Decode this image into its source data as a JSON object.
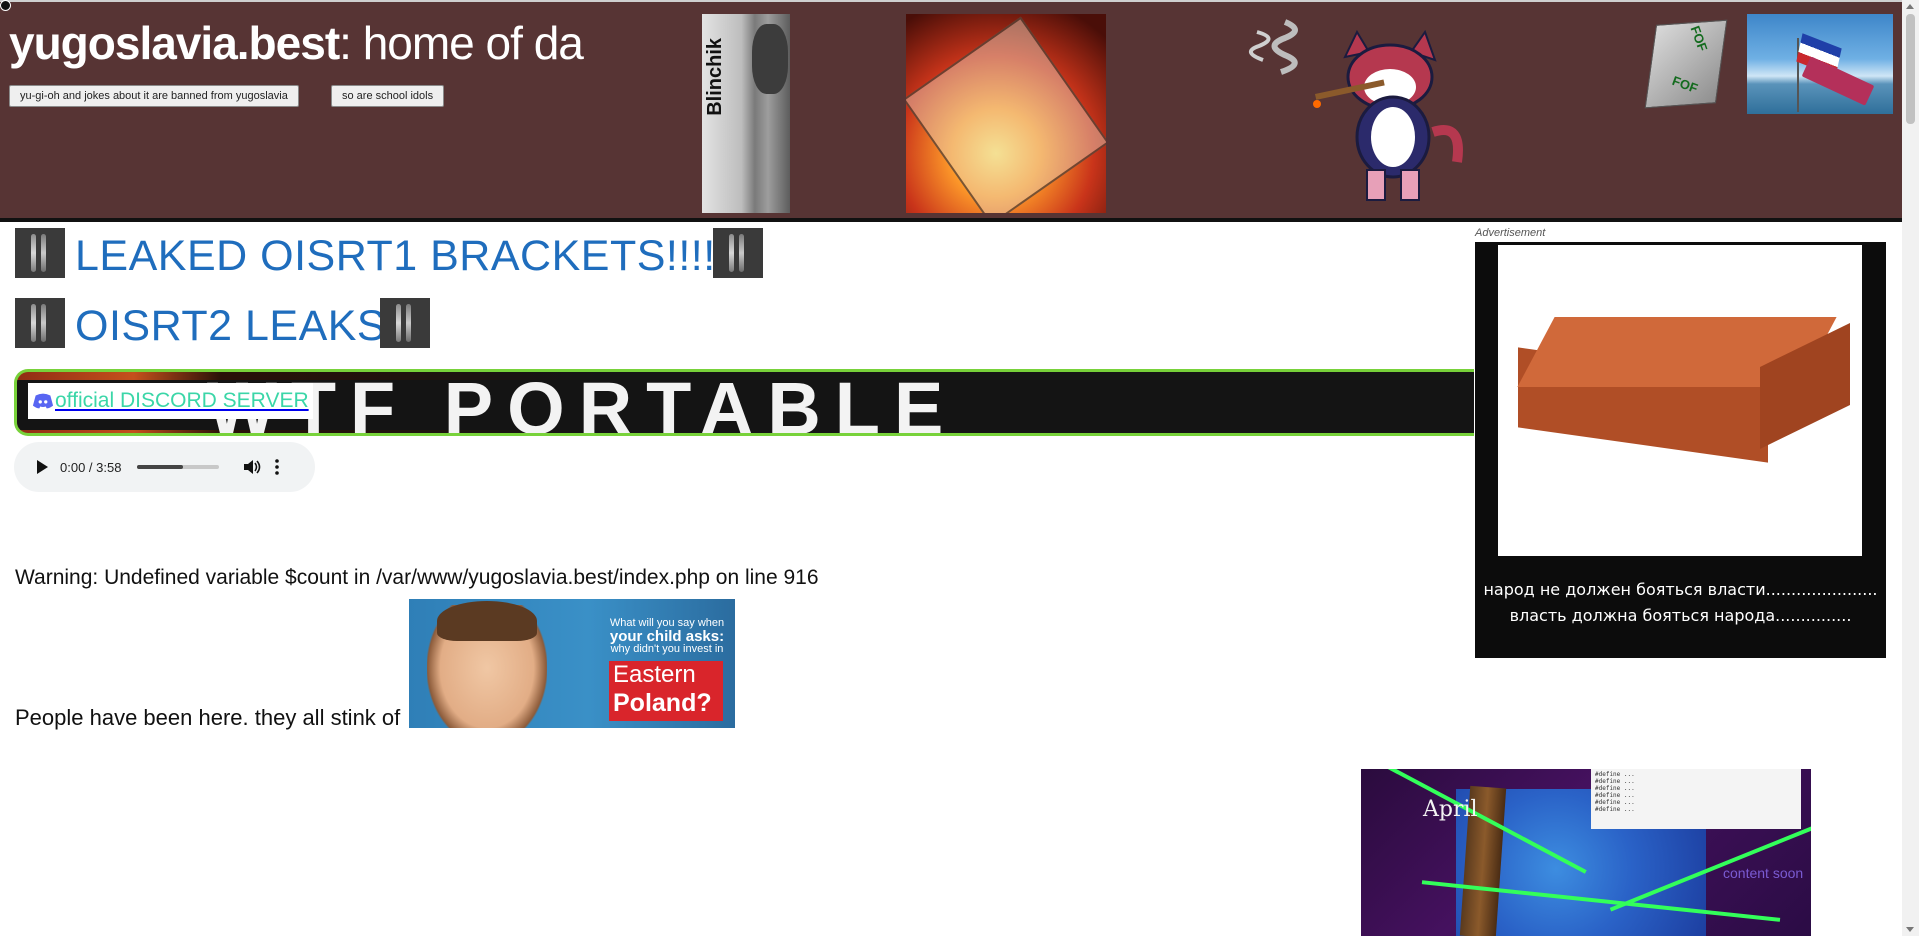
{
  "header": {
    "title_bold": "yugoslavia.best",
    "title_rest": ": home of da",
    "buttons": [
      {
        "label": "yu-gi-oh and jokes about it are banned from yugoslavia"
      },
      {
        "label": "so are school idols"
      }
    ],
    "blinchik_text": "Blinchik",
    "dice_text": "FOF"
  },
  "main": {
    "links": [
      {
        "label": "LEAKED OISRT1 BRACKETS!!!!!"
      },
      {
        "label": "OISRT2 LEAKS"
      }
    ],
    "banner_text": "WTF PORTABLE",
    "discord_label": "official DISCORD SERVER",
    "audio": {
      "time": "0:00 / 3:58",
      "volume_fraction": 0.55
    },
    "warning": "Warning: Undefined variable $count in /var/www/yugoslavia.best/index.php on line 916",
    "stink_text": "People have been here. they all stink of",
    "poland_ad": {
      "question_line1": "What will you say when",
      "question_line2": "your child asks:",
      "question_line3": "why didn't you invest in",
      "answer_line1": "Eastern",
      "answer_line2": "Poland?"
    }
  },
  "advertisement": {
    "label": "Advertisement",
    "line1": "народ не должен бояться власти......................",
    "line2": "власть должна бояться народа..............."
  },
  "april_image": {
    "tag": "April",
    "soon": "content soon"
  },
  "colors": {
    "header_bg": "#573434",
    "link": "#1f6dbd",
    "discord_text": "#3bd6a8",
    "banner_border": "#78d23a"
  }
}
